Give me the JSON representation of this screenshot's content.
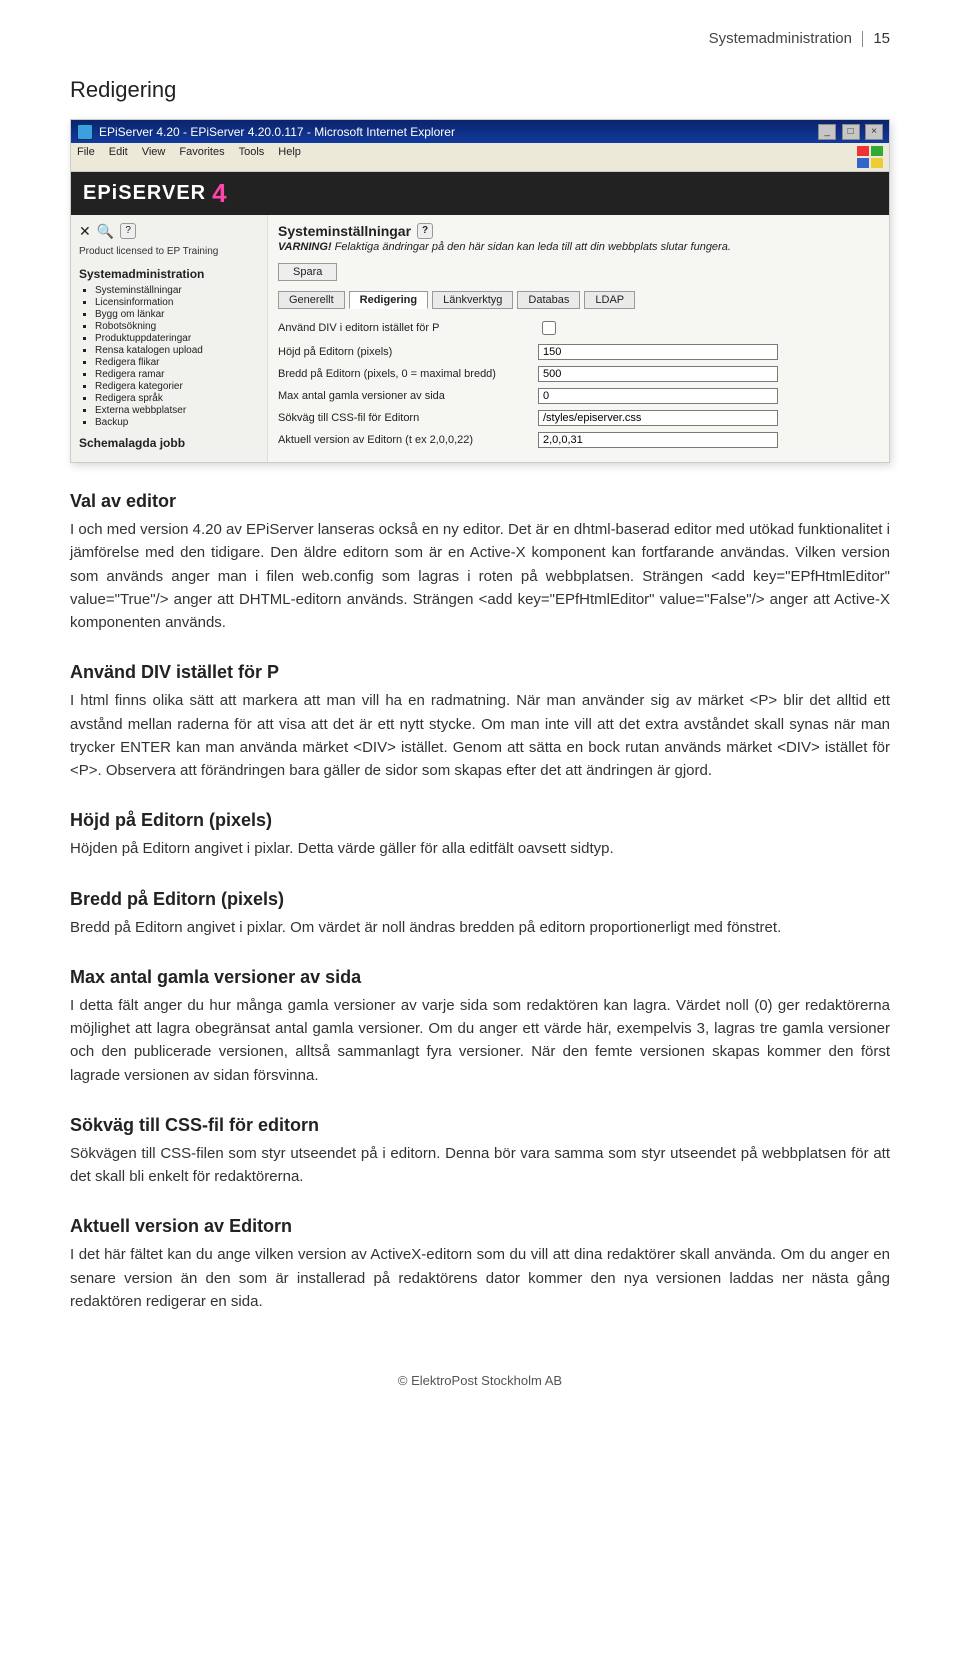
{
  "page_header": {
    "topic": "Systemadministration",
    "page_no": "15"
  },
  "h1": "Redigering",
  "screenshot": {
    "window_title": "EPiServer 4.20 - EPiServer 4.20.0.117 - Microsoft Internet Explorer",
    "menubar": [
      "File",
      "Edit",
      "View",
      "Favorites",
      "Tools",
      "Help"
    ],
    "brand_text": "EPiSERVER",
    "brand_suffix": "4",
    "license_text": "Product licensed to EP Training",
    "sidebar_heading": "Systemadministration",
    "sidebar_items": [
      "Systeminställningar",
      "Licensinformation",
      "Bygg om länkar",
      "Robotsökning",
      "Produktuppdateringar",
      "Rensa katalogen upload",
      "Redigera flikar",
      "Redigera ramar",
      "Redigera kategorier",
      "Redigera språk",
      "Externa webbplatser",
      "Backup"
    ],
    "sidebar_section2": "Schemalagda jobb",
    "right_title": "Systeminställningar",
    "warning_label": "VARNING!",
    "warning_text": "Felaktiga ändringar på den här sidan kan leda till att din webbplats slutar fungera.",
    "save_btn": "Spara",
    "tabs": [
      "Generellt",
      "Redigering",
      "Länkverktyg",
      "Databas",
      "LDAP"
    ],
    "active_tab_index": 1,
    "rows": [
      {
        "label": "Använd DIV i editorn istället för P",
        "type": "checkbox",
        "value": ""
      },
      {
        "label": "Höjd på Editorn (pixels)",
        "type": "text",
        "value": "150"
      },
      {
        "label": "Bredd på Editorn (pixels, 0 = maximal bredd)",
        "type": "text",
        "value": "500"
      },
      {
        "label": "Max antal gamla versioner av sida",
        "type": "text",
        "value": "0"
      },
      {
        "label": "Sökväg till CSS-fil för Editorn",
        "type": "text",
        "value": "/styles/episerver.css"
      },
      {
        "label": "Aktuell version av Editorn (t ex 2,0,0,22)",
        "type": "text",
        "value": "2,0,0,31"
      }
    ]
  },
  "sections": [
    {
      "heading": "Val av editor",
      "paragraphs": [
        "I och med version 4.20 av EPiServer lanseras också en ny editor. Det är en dhtml-baserad editor med utökad funktionalitet i jämförelse med den tidigare. Den äldre editorn som är en Active-X komponent kan fortfarande användas. Vilken version som används anger man i filen web.config som lagras i roten på webbplatsen. Strängen <add key=\"EPfHtmlEditor\" value=\"True\"/> anger att DHTML-editorn används. Strängen <add key=\"EPfHtmlEditor\" value=\"False\"/> anger att Active-X komponenten används."
      ]
    },
    {
      "heading": "Använd DIV istället för P",
      "paragraphs": [
        "I html finns olika sätt att markera att man vill ha en radmatning. När man använder sig av märket <P> blir det alltid ett avstånd mellan raderna för att visa att det är ett nytt stycke. Om man inte vill att det extra avståndet skall synas när man trycker ENTER kan man använda märket <DIV> istället. Genom att sätta en bock rutan används märket <DIV> istället för <P>. Observera att förändringen bara gäller de sidor som skapas efter det att ändringen är gjord."
      ]
    },
    {
      "heading": "Höjd på Editorn (pixels)",
      "paragraphs": [
        "Höjden på Editorn angivet i pixlar. Detta värde gäller för alla editfält oavsett sidtyp."
      ]
    },
    {
      "heading": "Bredd på Editorn (pixels)",
      "paragraphs": [
        "Bredd på Editorn angivet i pixlar. Om värdet är noll ändras bredden på editorn proportionerligt med fönstret."
      ]
    },
    {
      "heading": "Max antal gamla versioner av sida",
      "paragraphs": [
        "I detta fält anger du hur många gamla versioner av varje sida som redaktören kan lagra. Värdet noll (0) ger redaktörerna möjlighet att lagra obegränsat antal gamla versioner. Om du anger ett värde här, exempelvis 3, lagras tre gamla versioner och den publicerade versionen, alltså sammanlagt fyra versioner. När den femte versionen skapas kommer den först lagrade versionen av sidan försvinna."
      ]
    },
    {
      "heading": "Sökväg till CSS-fil för editorn",
      "paragraphs": [
        "Sökvägen till CSS-filen som styr utseendet på i editorn. Denna bör vara samma som styr utseendet på webbplatsen för att det skall bli enkelt för redaktörerna."
      ]
    },
    {
      "heading": "Aktuell version av Editorn",
      "paragraphs": [
        "I det här fältet kan du ange vilken version av ActiveX-editorn som du vill att dina redaktörer skall använda. Om du anger en senare version än den som är installerad på redaktörens dator kommer den nya versionen laddas ner nästa gång redaktören redigerar en sida."
      ]
    }
  ],
  "footer": "© ElektroPost Stockholm AB"
}
